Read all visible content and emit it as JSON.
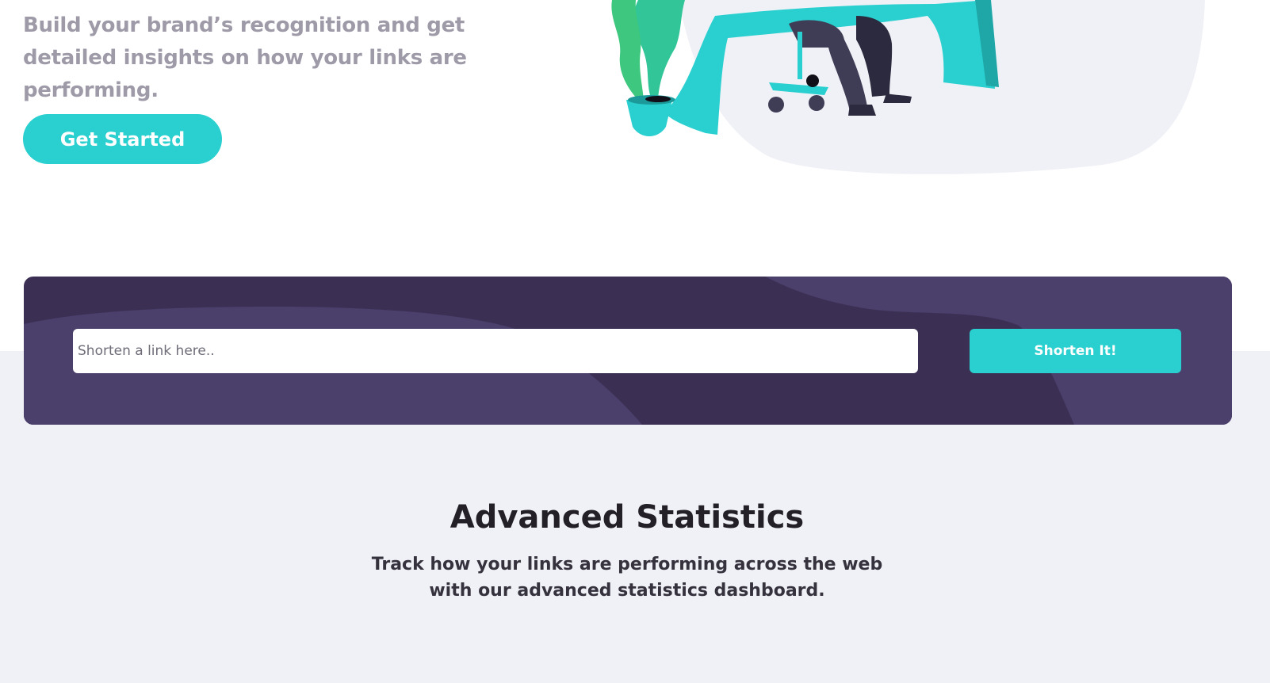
{
  "hero": {
    "description": "Build your brand’s recognition and get detailed insights on how your links are performing.",
    "cta_label": "Get Started"
  },
  "shortener": {
    "input_placeholder": "Shorten a link here..",
    "input_value": "",
    "button_label": "Shorten It!"
  },
  "statistics": {
    "title": "Advanced Statistics",
    "subtitle": "Track how your links are performing across the web with our advanced statistics dashboard."
  },
  "colors": {
    "cyan": "#2acfcf",
    "dark_violet": "#3b3054",
    "grayish_violet": "#9e9aa8",
    "light_gray": "#f0f1f6",
    "very_dark_blue": "#35323e"
  }
}
